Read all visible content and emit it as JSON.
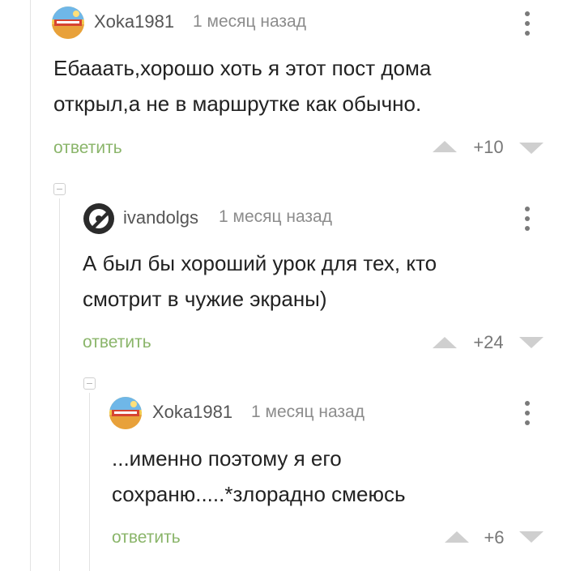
{
  "comments": [
    {
      "username": "Xoka1981",
      "time": "1 месяц назад",
      "text_lines": [
        "Ебааать,хорошо хоть я этот пост дома",
        "открыл,а не в маршрутке как обычно."
      ],
      "reply_label": "ответить",
      "rating": "+10",
      "avatar_icon": "avatar-travel-logo-icon"
    },
    {
      "username": "ivandolgs",
      "time": "1 месяц назад",
      "text_lines": [
        "А был бы хороший урок для тех, кто",
        "смотрит в чужие экраны)"
      ],
      "reply_label": "ответить",
      "rating": "+24",
      "avatar_icon": "avatar-monochrome-icon"
    },
    {
      "username": "Xoka1981",
      "time": "1 месяц назад",
      "text_lines": [
        "...именно поэтому я его",
        "сохраню.....*злорадно смеюсь"
      ],
      "reply_label": "ответить",
      "rating": "+6",
      "avatar_icon": "avatar-travel-logo-icon"
    }
  ],
  "colors": {
    "reply_link": "#8ab56a",
    "vote_arrow": "#cfcfcf",
    "thread_line": "#e3e3e3"
  }
}
